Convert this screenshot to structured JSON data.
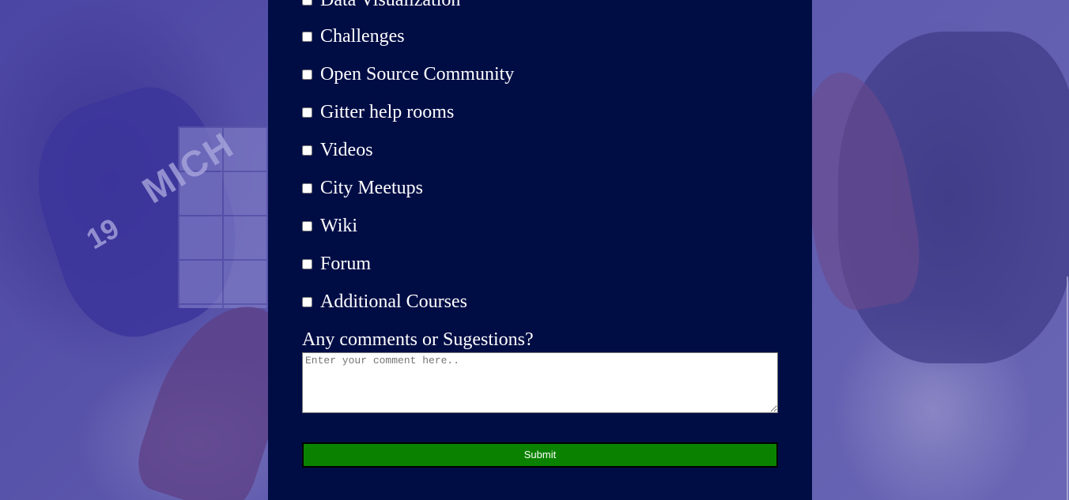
{
  "form": {
    "options": [
      {
        "label": "Data Visualization",
        "checked": false
      },
      {
        "label": "Challenges",
        "checked": false
      },
      {
        "label": "Open Source Community",
        "checked": false
      },
      {
        "label": "Gitter help rooms",
        "checked": false
      },
      {
        "label": "Videos",
        "checked": false
      },
      {
        "label": "City Meetups",
        "checked": false
      },
      {
        "label": "Wiki",
        "checked": false
      },
      {
        "label": "Forum",
        "checked": false
      },
      {
        "label": "Additional Courses",
        "checked": false
      }
    ],
    "comments_label": "Any comments or Sugestions?",
    "comments_placeholder": "Enter your comment here..",
    "comments_value": "",
    "submit_label": "Submit"
  },
  "colors": {
    "panel_background": "#000d45",
    "submit_background": "#0a8200",
    "text": "#ffffff",
    "page_background_tint": "#5a55a8"
  },
  "background": {
    "shirt_print_text": "MICH",
    "shirt_print_number": "19"
  }
}
